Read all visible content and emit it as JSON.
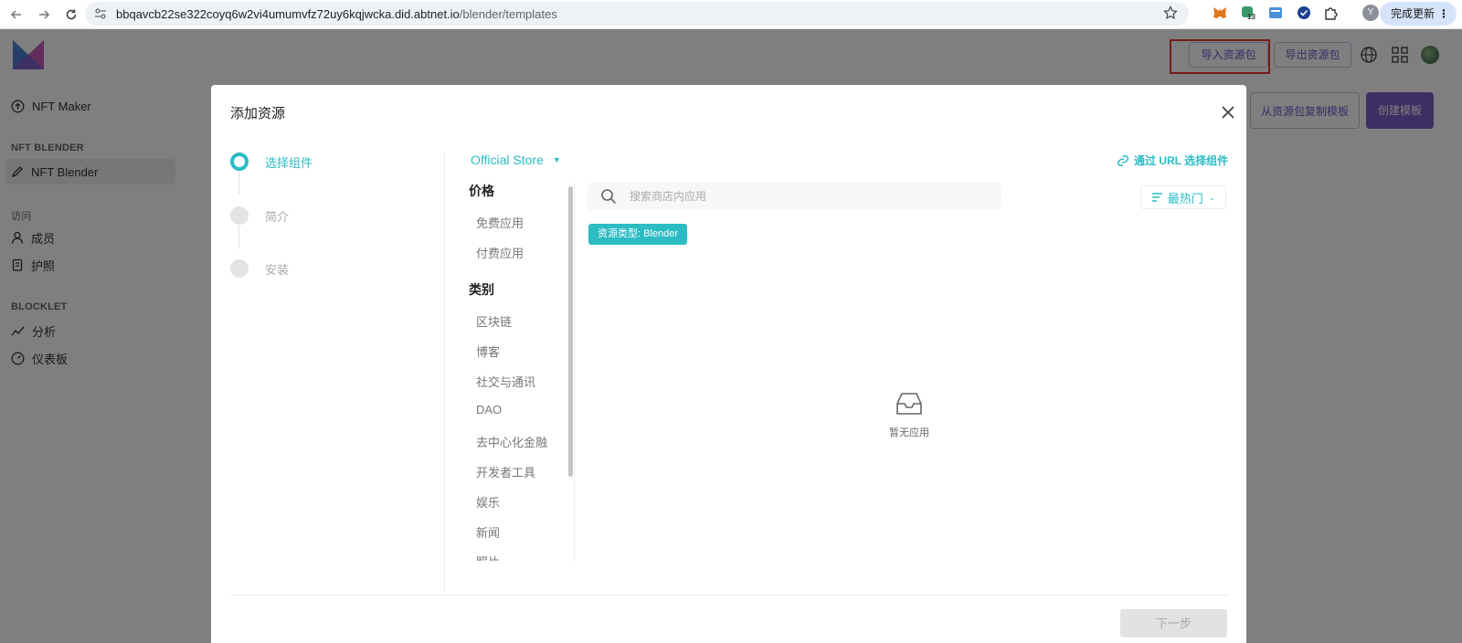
{
  "browser": {
    "url_domain": "bbqavcb22se322coyq6w2vi4umumvfz72uy6kqjwcka.did.abtnet.io",
    "url_path": "/blender/templates",
    "extension_badge": "13",
    "profile_initial": "Y",
    "update_label": "完成更新",
    "update_menu": "⋮"
  },
  "header": {
    "import_label": "导入资源包",
    "export_label": "导出资源包"
  },
  "sidebar": {
    "nft_maker": "NFT Maker",
    "section_blender": "NFT BLENDER",
    "nft_blender": "NFT Blender",
    "section_access": "访问",
    "members": "成员",
    "passport": "护照",
    "section_blocklet": "BLOCKLET",
    "analytics": "分析",
    "dashboard": "仪表板"
  },
  "page_actions": {
    "copy_from_bundle": "从资源包复制模板",
    "create_template": "创建模板"
  },
  "modal": {
    "title": "添加资源",
    "steps": [
      {
        "label": "选择组件",
        "state": "active"
      },
      {
        "label": "简介",
        "state": "todo"
      },
      {
        "label": "安装",
        "state": "todo"
      }
    ],
    "store": "Official Store",
    "url_link": "通过 URL 选择组件",
    "search_placeholder": "搜索商店内应用",
    "sort_label": "最热门",
    "tag": "资源类型: Blender",
    "filters": {
      "price_head": "价格",
      "price": [
        "免费应用",
        "付费应用"
      ],
      "category_head": "类别",
      "categories": [
        "区块链",
        "博客",
        "社交与通讯",
        "DAO",
        "去中心化金融",
        "开发者工具",
        "娱乐",
        "新闻",
        "照片"
      ]
    },
    "empty_text": "暂无应用",
    "next_label": "下一步"
  },
  "colors": {
    "accent": "#2bbcc4",
    "brand_purple": "#7b5fc7",
    "highlight_red": "#e53935"
  }
}
